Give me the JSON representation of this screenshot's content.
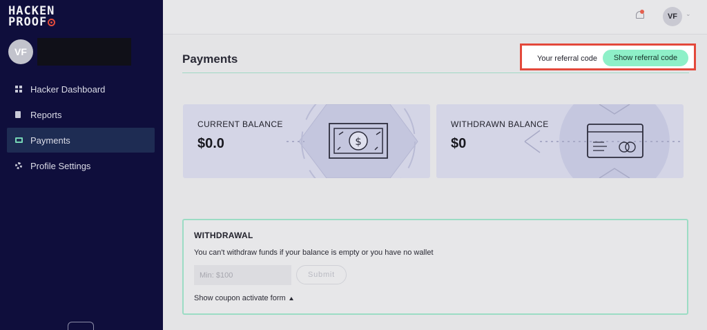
{
  "app": {
    "logo_line1": "HACKEN",
    "logo_line2": "PROOF"
  },
  "sidebar": {
    "avatar_initials": "VF",
    "items": [
      {
        "label": "Hacker Dashboard",
        "icon": "dashboard-grid-icon",
        "active": false
      },
      {
        "label": "Reports",
        "icon": "document-icon",
        "active": false
      },
      {
        "label": "Payments",
        "icon": "credit-card-icon",
        "active": true
      },
      {
        "label": "Profile Settings",
        "icon": "gear-icon",
        "active": false
      }
    ]
  },
  "header": {
    "user_initials": "VF",
    "notification_icon": "bell-icon"
  },
  "page": {
    "title": "Payments",
    "referral_label": "Your referral code",
    "referral_button": "Show referral code"
  },
  "cards": {
    "current_label": "CURRENT BALANCE",
    "current_value": "$0.0",
    "withdrawn_label": "WITHDRAWN BALANCE",
    "withdrawn_value": "$0"
  },
  "withdrawal": {
    "title": "WITHDRAWAL",
    "message": "You can't withdraw funds if your balance is empty or you have no wallet",
    "amount_placeholder": "Min: $100",
    "submit_label": "Submit",
    "coupon_toggle": "Show coupon activate form"
  },
  "colors": {
    "sidebar_bg": "#0f0e3c",
    "accent_mint": "#8ef0c8",
    "highlight_red": "#e3483a",
    "card_bg": "#d4d5e6"
  }
}
